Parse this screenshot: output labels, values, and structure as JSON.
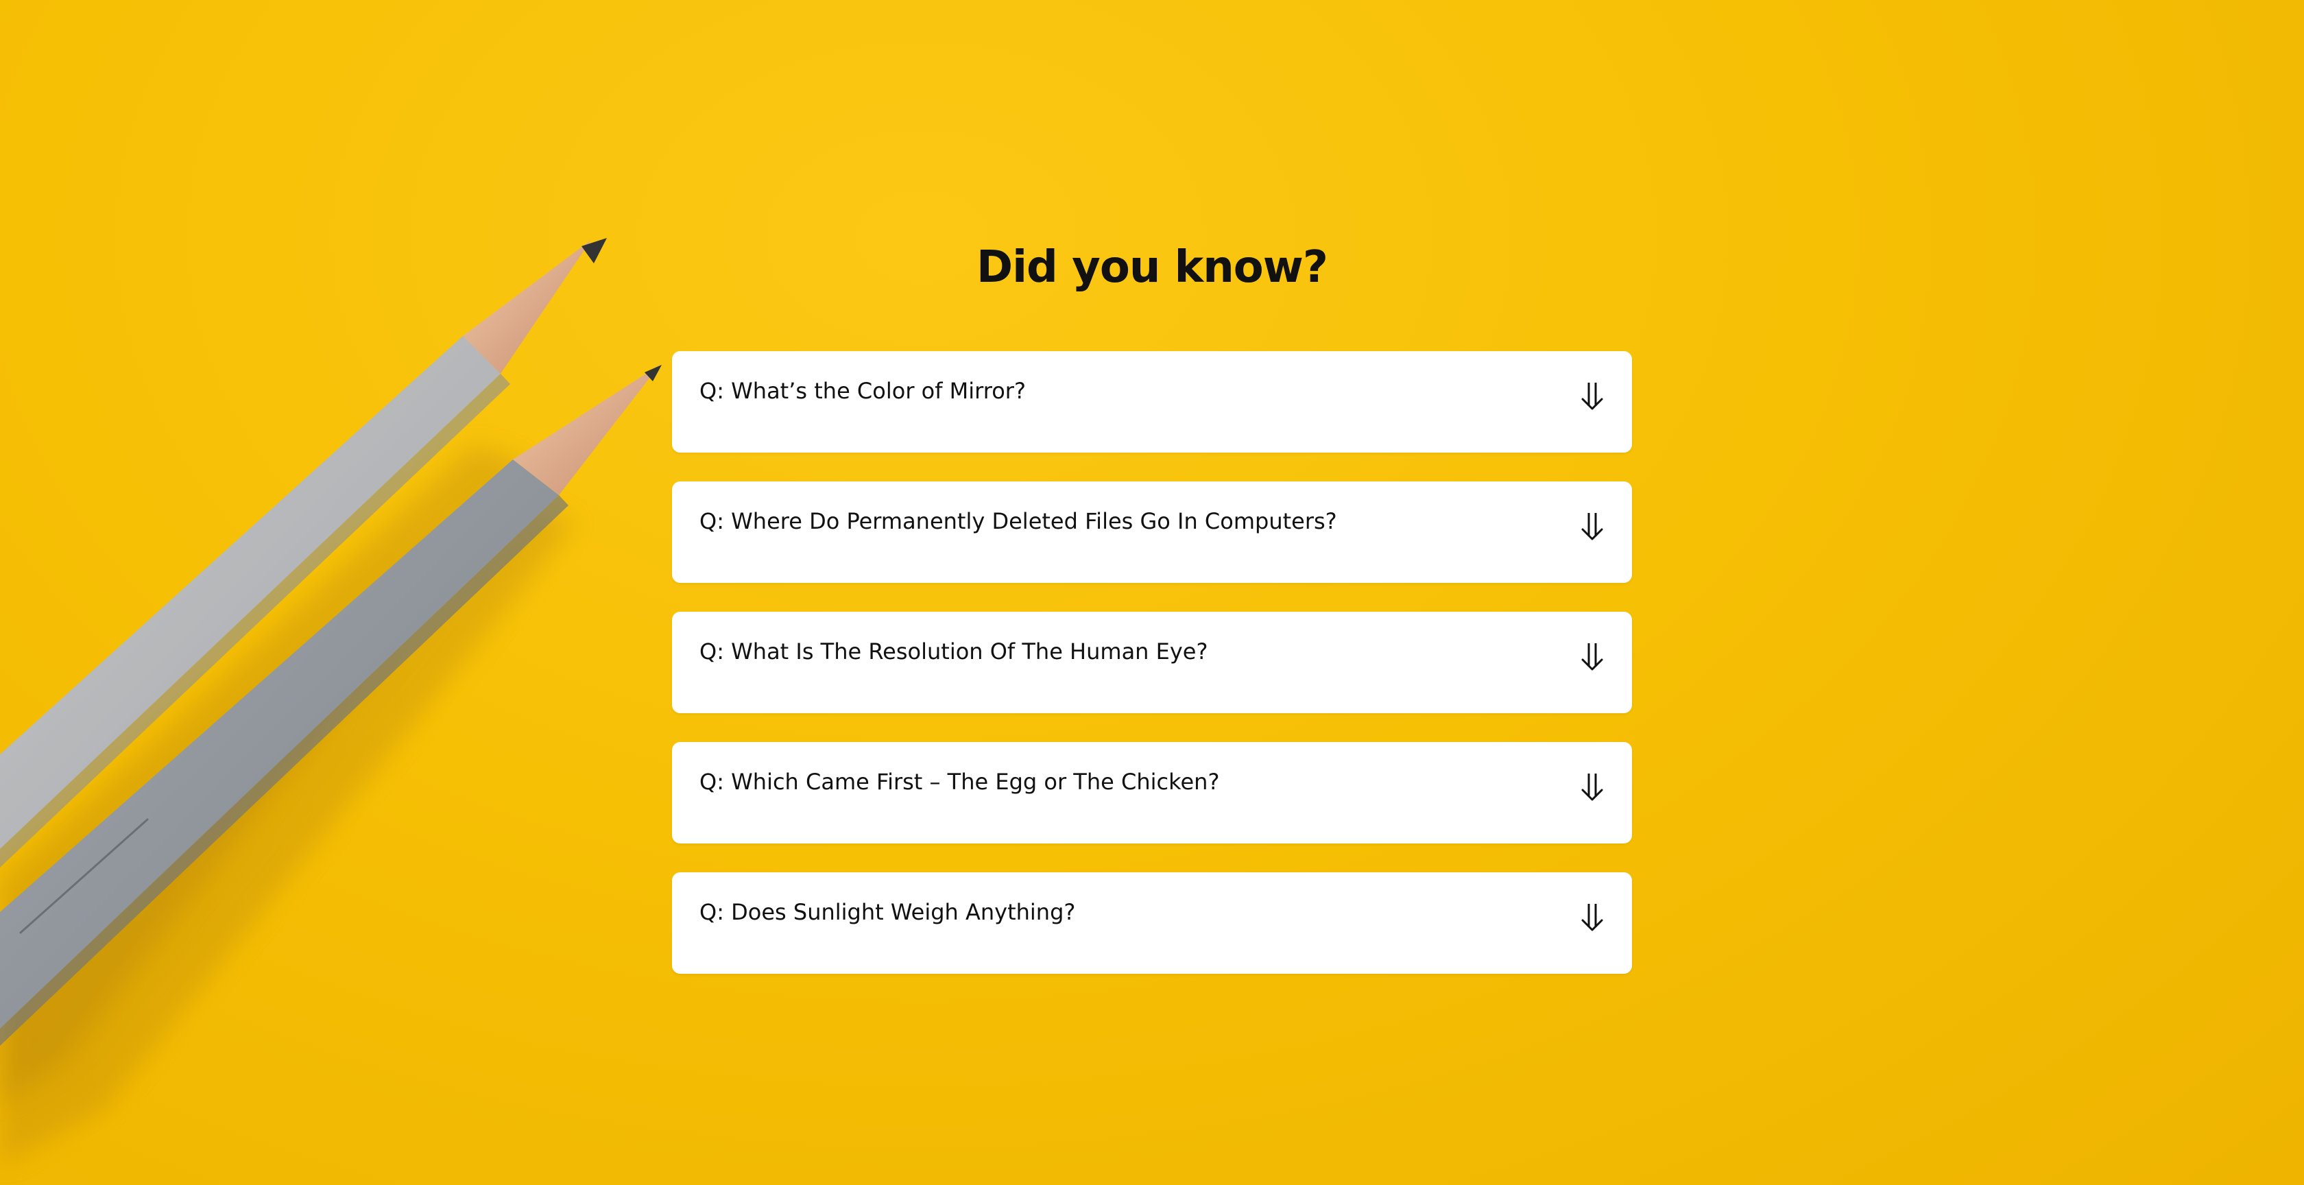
{
  "page": {
    "title": "Did you know?"
  },
  "faq": {
    "items": [
      {
        "question": "Q: What’s the Color of Mirror?",
        "icon": "double-arrow-down-icon"
      },
      {
        "question": "Q: Where Do Permanently Deleted Files Go In Computers?",
        "icon": "double-arrow-down-icon"
      },
      {
        "question": "Q: What Is The Resolution Of The Human Eye?",
        "icon": "double-arrow-down-icon"
      },
      {
        "question": "Q: Which Came First – The Egg or The Chicken?",
        "icon": "double-arrow-down-icon"
      },
      {
        "question": "Q: Does Sunlight Weigh Anything?",
        "icon": "double-arrow-down-icon"
      }
    ]
  },
  "colors": {
    "background": "#f6c005",
    "card": "#ffffff",
    "text": "#111111"
  }
}
